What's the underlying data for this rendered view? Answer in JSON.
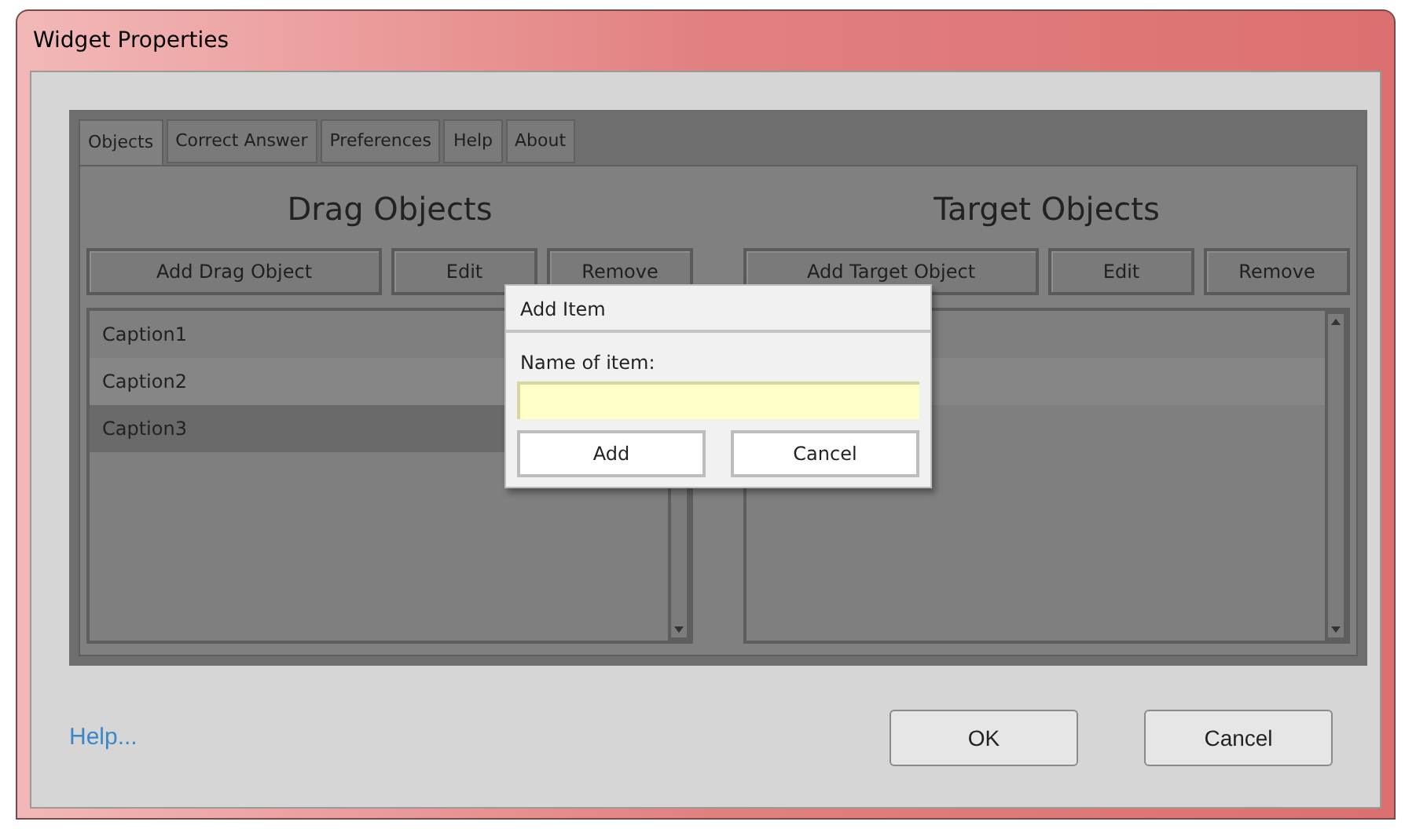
{
  "window": {
    "title": "Widget Properties"
  },
  "tabs": [
    {
      "label": "Objects",
      "selected": true
    },
    {
      "label": "Correct Answer",
      "selected": false
    },
    {
      "label": "Preferences",
      "selected": false
    },
    {
      "label": "Help",
      "selected": false
    },
    {
      "label": "About",
      "selected": false
    }
  ],
  "drag_objects": {
    "heading": "Drag Objects",
    "buttons": [
      "Add Drag Object",
      "Edit",
      "Remove"
    ],
    "items": [
      {
        "label": "Caption1",
        "selected": false
      },
      {
        "label": "Caption2",
        "selected": false
      },
      {
        "label": "Caption3",
        "selected": true
      }
    ]
  },
  "target_objects": {
    "heading": "Target Objects",
    "buttons": [
      "Add Target Object",
      "Edit",
      "Remove"
    ]
  },
  "dialog": {
    "title": "Add Item",
    "label": "Name of item:",
    "buttons": [
      "Add",
      "Cancel"
    ]
  },
  "footer": {
    "link": "Help...",
    "buttons": [
      "OK",
      "Cancel"
    ]
  }
}
